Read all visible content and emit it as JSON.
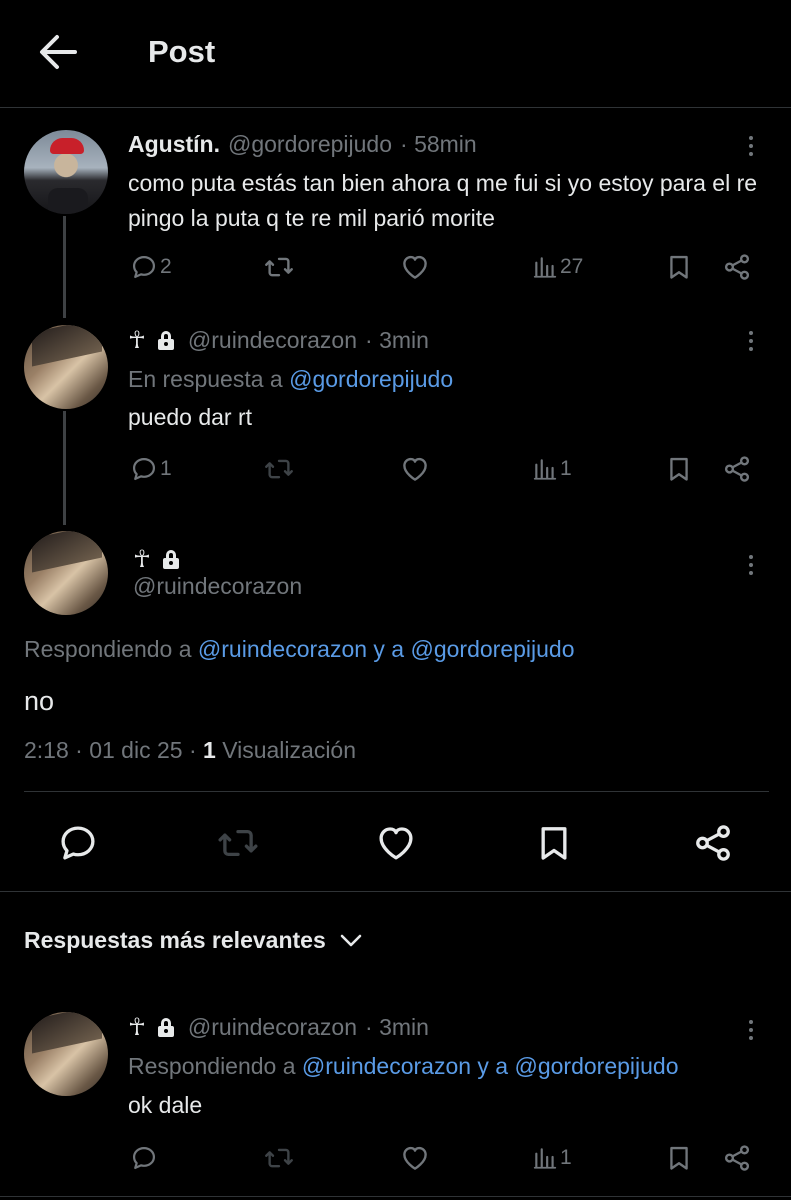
{
  "header": {
    "title": "Post"
  },
  "tweets": [
    {
      "name": "Agustín.",
      "handle": "@gordorepijudo",
      "time": "· 58min",
      "text": "como puta estás tan bien ahora q me fui si yo estoy para el re pingo la puta q te re mil parió morite",
      "replies": "2",
      "views": "27"
    },
    {
      "cross": "☥",
      "handle": "@ruindecorazon",
      "time": "· 3min",
      "reply_prefix": "En respuesta a",
      "reply_target": "@gordorepijudo",
      "text": "puedo dar rt",
      "replies": "1",
      "views": "1"
    }
  ],
  "main": {
    "cross": "☥",
    "handle": "@ruindecorazon",
    "reply_prefix": "Respondiendo a",
    "reply_targets": "@ruindecorazon y a @gordorepijudo",
    "text": "no",
    "timestamp": "2:18 · 01 dic 25 ·",
    "views_count": "1",
    "views_label": "Visualización"
  },
  "sort_label": "Respuestas más relevantes",
  "reply": {
    "cross": "☥",
    "handle": "@ruindecorazon",
    "time": "· 3min",
    "reply_prefix": "Respondiendo a",
    "reply_targets": "@ruindecorazon y a @gordorepijudo",
    "text": "ok dale",
    "views": "1"
  },
  "colors": {
    "background": "#000000",
    "text": "#e7e9ea",
    "muted": "#71767b",
    "link": "#5a9be6",
    "divider": "#2f3336"
  },
  "icons": [
    "back-arrow-icon",
    "more-icon",
    "reply-icon",
    "retweet-icon",
    "like-icon",
    "views-icon",
    "bookmark-icon",
    "share-icon",
    "lock-icon",
    "chevron-down-icon"
  ]
}
